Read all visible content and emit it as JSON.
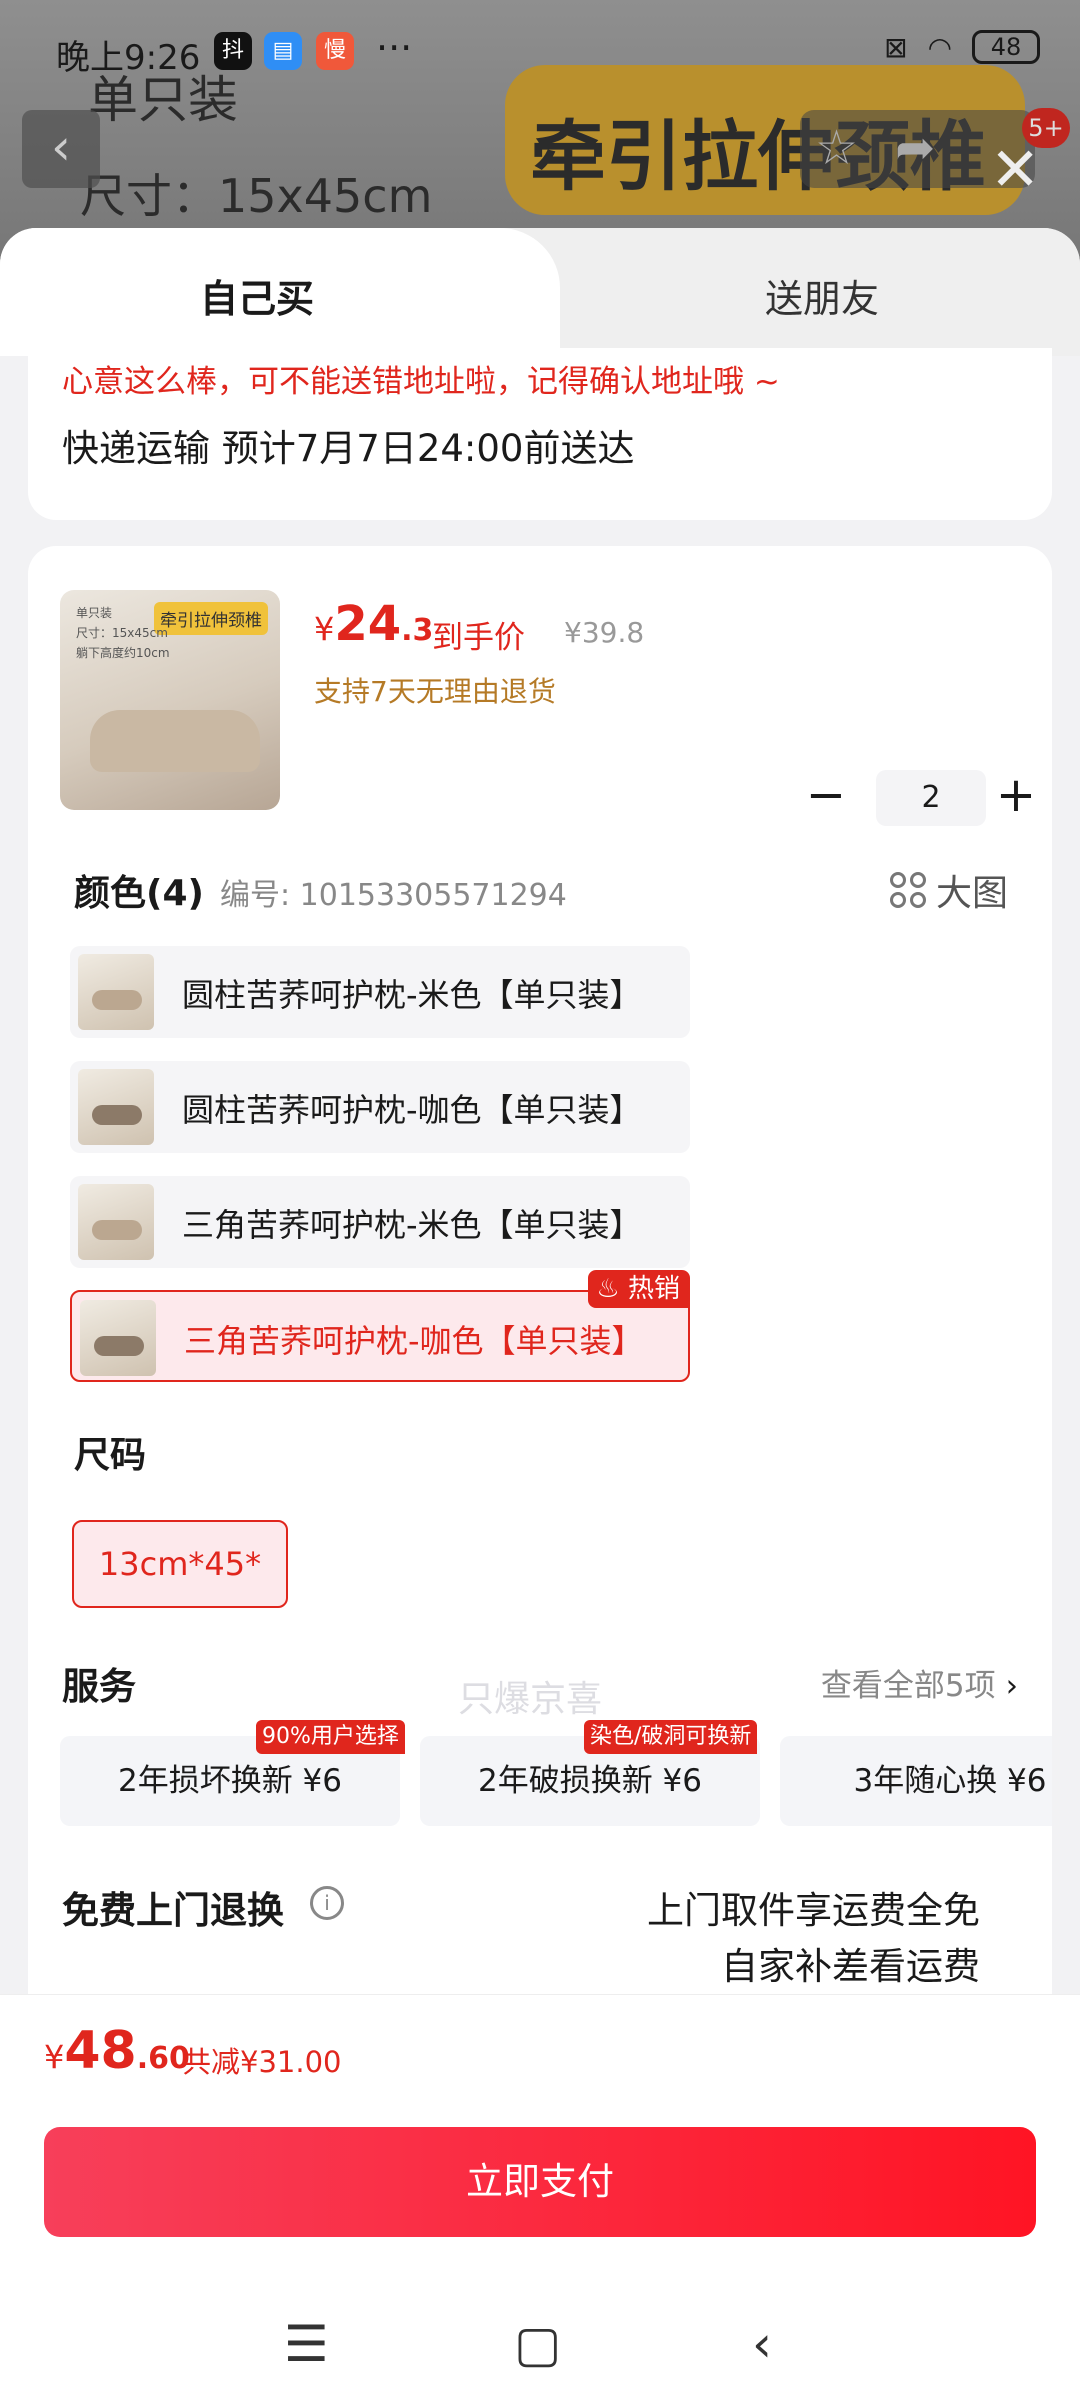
{
  "status_bar": {
    "time": "晚上9:26",
    "apps": [
      "抖",
      "▤",
      "慢"
    ],
    "more": "···",
    "battery": "48"
  },
  "background": {
    "line1": "单只装",
    "line2": "尺寸：15x45cm",
    "banner": "牵引拉伸颈椎",
    "badge": "5+"
  },
  "tabs": {
    "self": "自己买",
    "gift": "送朋友"
  },
  "address": {
    "warning": "心意这么棒，可不能送错地址啦，记得确认地址哦 ~",
    "shipping": "快递运输 预计7月7日24:00前送达"
  },
  "product": {
    "thumb_tag": "牵引拉伸颈椎",
    "thumb_line1": "单只装",
    "thumb_line2": "尺寸：15x45cm",
    "thumb_line3": "躺下高度约10cm",
    "price_currency": "¥",
    "price_int": "24",
    "price_dec": ".3",
    "price_label": "到手价",
    "original_price": "¥39.8",
    "returns": "支持7天无理由退货",
    "quantity": "2"
  },
  "color": {
    "heading": "颜色(4)",
    "sku": "编号: 10153305571294",
    "big_pic": "大图",
    "options": [
      {
        "label": "圆柱苦荞呵护枕-米色【单只装】"
      },
      {
        "label": "圆柱苦荞呵护枕-咖色【单只装】"
      },
      {
        "label": "三角苦荞呵护枕-米色【单只装】"
      },
      {
        "label": "三角苦荞呵护枕-咖色【单只装】",
        "badge": "热销"
      }
    ]
  },
  "watermark": "只爆京喜",
  "size": {
    "heading": "尺码",
    "option": "13cm*45*"
  },
  "services": {
    "heading": "服务",
    "view_all": "查看全部5项",
    "items": [
      {
        "label": "2年损坏换新  ¥6",
        "badge": "90%用户选择"
      },
      {
        "label": "2年破损换新  ¥6",
        "badge": "染色/破洞可换新"
      },
      {
        "label": "3年随心换  ¥6"
      }
    ]
  },
  "free_return": {
    "heading": "免费上门退换",
    "line1": "上门取件享运费全免",
    "line2": "自家补差看运费"
  },
  "footer": {
    "total_currency": "¥",
    "total_int": "48",
    "total_dec": ".60",
    "discount": "共减¥31.00",
    "pay_button": "立即支付"
  },
  "colors": {
    "accent": "#e0261d",
    "pay_gradient_start": "#f73f5a",
    "pay_gradient_end": "#ff1424"
  }
}
